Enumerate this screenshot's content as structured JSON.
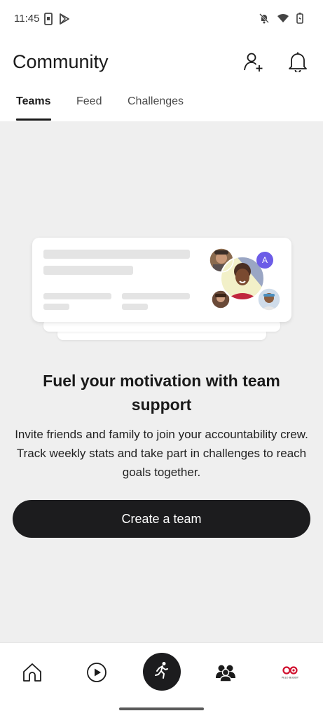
{
  "status_bar": {
    "time": "11:45"
  },
  "header": {
    "title": "Community"
  },
  "tabs": [
    {
      "label": "Teams",
      "active": true
    },
    {
      "label": "Feed",
      "active": false
    },
    {
      "label": "Challenges",
      "active": false
    }
  ],
  "illustration": {
    "avatar_letter": "A"
  },
  "empty_state": {
    "headline": "Fuel your motivation with team support",
    "body": "Invite friends and family to join your accountability crew. Track weekly stats and take part in challenges to reach goals together."
  },
  "cta": {
    "label": "Create a team"
  },
  "bottom_nav": {
    "items": [
      "home-icon",
      "play-icon",
      "run-icon",
      "community-icon",
      "pelo-buddy-logo"
    ],
    "logo_text": "PELO BUDDY"
  },
  "colors": {
    "accent": "#1c1c1e",
    "avatar_accent": "#6c5ce7",
    "logo_red": "#d0102e"
  }
}
